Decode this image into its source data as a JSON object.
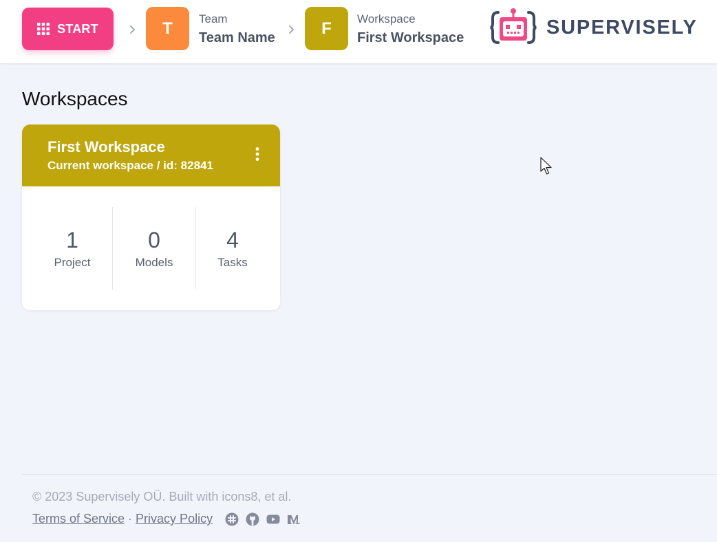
{
  "header": {
    "start_label": "START",
    "team": {
      "initial": "T",
      "label": "Team",
      "name": "Team Name",
      "color": "#fb8a3c"
    },
    "workspace": {
      "initial": "F",
      "label": "Workspace",
      "name": "First Workspace",
      "color": "#bfa60c"
    },
    "logo_text": "SUPERVISELY"
  },
  "main": {
    "title": "Workspaces",
    "card": {
      "title": "First Workspace",
      "subtitle": "Current workspace  / id: 82841",
      "color": "#bfa60c",
      "stats": [
        {
          "value": "1",
          "label": "Project"
        },
        {
          "value": "0",
          "label": "Models"
        },
        {
          "value": "4",
          "label": "Tasks"
        }
      ]
    }
  },
  "footer": {
    "copyright": "© 2023 Supervisely OÜ. Built with icons8, et al.",
    "terms": "Terms of Service",
    "separator": "·",
    "privacy": "Privacy Policy",
    "social_icons": [
      "slack-icon",
      "github-icon",
      "youtube-icon",
      "medium-icon"
    ]
  },
  "colors": {
    "start": "#f23f84",
    "background": "#f2f4fb",
    "logo_robot": "#ee4a86",
    "logo_text": "#3e4a63"
  }
}
